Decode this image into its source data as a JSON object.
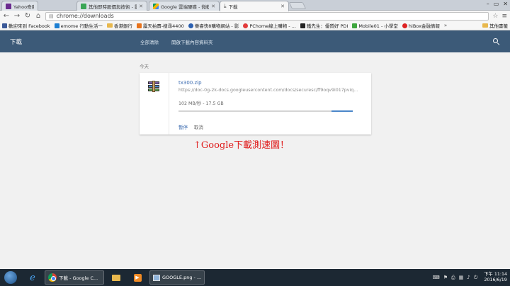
{
  "tabs": [
    {
      "title": "Yahoo奇摩",
      "active": false
    },
    {
      "title": "其他即時股價與技術 - 影",
      "active": false
    },
    {
      "title": "Google 雲端硬碟 - 微軟",
      "active": false
    },
    {
      "title": "下載",
      "active": true
    }
  ],
  "toolbar": {
    "url": "chrome://downloads"
  },
  "bookmarks": [
    {
      "label": "歡迎來到 Facebook"
    },
    {
      "label": "emome 行動生活一"
    },
    {
      "label": "香港銀行"
    },
    {
      "label": "露天拍賣-搜尋4400"
    },
    {
      "label": "樂睿快8購物網站 - 影"
    },
    {
      "label": "PChome線上購物 - ..."
    },
    {
      "label": "鐵先生：優質好 PDI"
    },
    {
      "label": "Mobile01 - 小學堂"
    },
    {
      "label": "hiBox金融情報"
    }
  ],
  "bookmarks_other": "其他書籤",
  "downloads_page": {
    "title": "下載",
    "clear_all": "全部清除",
    "open_folder": "開啟下載內容資料夾",
    "date_label": "今天"
  },
  "download_item": {
    "filename": "tx300.zip",
    "url": "https://doc-0g-2k-docs.googleusercontent.com/docs/securesc/ff9oqv9i017pviq...",
    "status": "102 MB/秒 - 17.5 GB",
    "progress": 0.12,
    "pause_label": "暫停",
    "cancel_label": "取消"
  },
  "caption": "↑Google下載測速圖！",
  "taskbar": {
    "tasks": [
      {
        "label": "下載 - Google C..."
      },
      {
        "label": "GOOGLE.png - ..."
      }
    ],
    "time": "下午 11:14",
    "date": "2016/6/19"
  },
  "colors": {
    "header_bg": "#3c5a78",
    "link": "#3b6bb0",
    "progress_fill": "#4a86c9",
    "caption": "#e01b1b",
    "taskbar_bg": "#1c2833"
  }
}
